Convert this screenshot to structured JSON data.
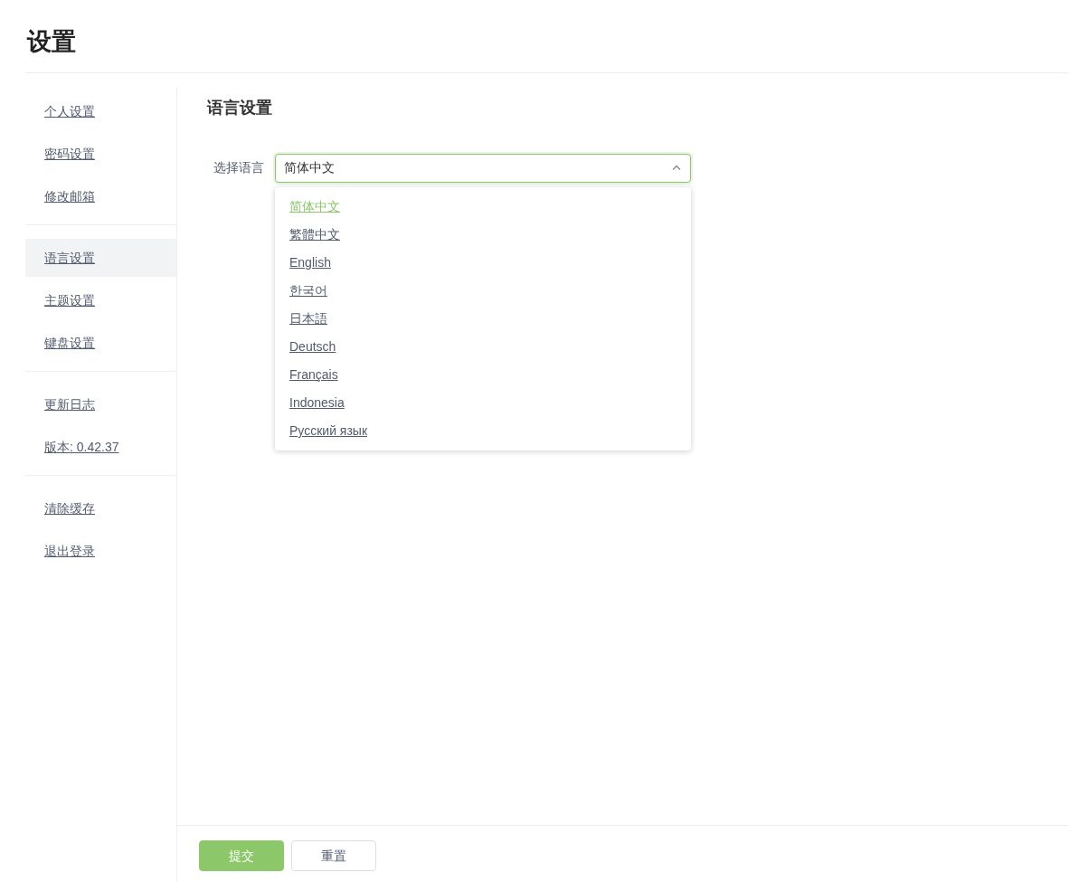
{
  "page_title": "设置",
  "sidebar": {
    "groups": [
      {
        "items": [
          {
            "label": "个人设置",
            "selected": false
          },
          {
            "label": "密码设置",
            "selected": false
          },
          {
            "label": "修改邮箱",
            "selected": false
          }
        ]
      },
      {
        "items": [
          {
            "label": "语言设置",
            "selected": true
          },
          {
            "label": "主题设置",
            "selected": false
          },
          {
            "label": "键盘设置",
            "selected": false
          }
        ]
      },
      {
        "items": [
          {
            "label": "更新日志",
            "selected": false
          },
          {
            "label": "版本: 0.42.37",
            "selected": false
          }
        ]
      },
      {
        "items": [
          {
            "label": "清除缓存",
            "selected": false
          },
          {
            "label": "退出登录",
            "selected": false
          }
        ]
      }
    ]
  },
  "section_title": "语言设置",
  "language_field": {
    "label": "选择语言",
    "value": "简体中文",
    "expanded": true,
    "options": [
      {
        "label": "简体中文",
        "selected": true
      },
      {
        "label": "繁體中文",
        "selected": false
      },
      {
        "label": "English",
        "selected": false
      },
      {
        "label": "한국어",
        "selected": false
      },
      {
        "label": "日本語",
        "selected": false
      },
      {
        "label": "Deutsch",
        "selected": false
      },
      {
        "label": "Français",
        "selected": false
      },
      {
        "label": "Indonesia",
        "selected": false
      },
      {
        "label": "Русский язык",
        "selected": false
      }
    ]
  },
  "buttons": [
    {
      "label": "提交",
      "kind": "primary"
    },
    {
      "label": "重置",
      "kind": "default"
    }
  ]
}
